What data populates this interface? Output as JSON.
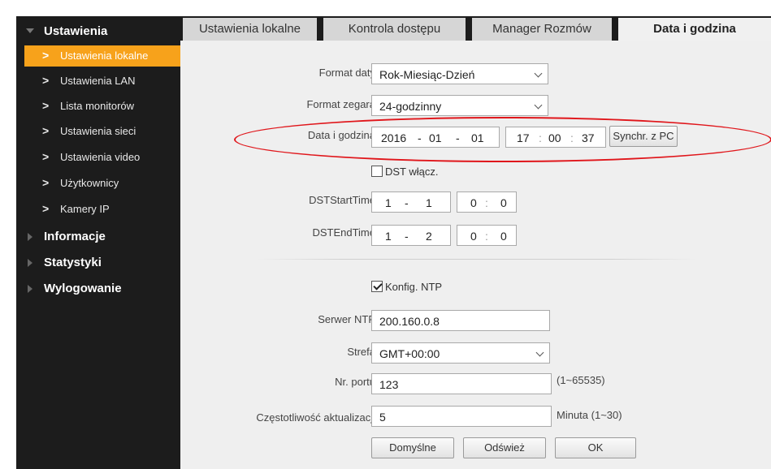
{
  "sidebar": {
    "sections": [
      {
        "label": "Ustawienia",
        "expanded": true
      },
      {
        "label": "Informacje",
        "expanded": false
      },
      {
        "label": "Statystyki",
        "expanded": false
      },
      {
        "label": "Wylogowanie",
        "expanded": false
      }
    ],
    "items": [
      {
        "label": "Ustawienia lokalne",
        "active": true
      },
      {
        "label": "Ustawienia LAN"
      },
      {
        "label": "Lista monitorów"
      },
      {
        "label": "Ustawienia sieci"
      },
      {
        "label": "Ustawienia video"
      },
      {
        "label": "Użytkownicy"
      },
      {
        "label": "Kamery IP"
      }
    ],
    "chevron": ">"
  },
  "tabs": [
    {
      "label": "Ustawienia lokalne"
    },
    {
      "label": "Kontrola dostępu"
    },
    {
      "label": "Manager Rozmów"
    },
    {
      "label": "Data i godzina",
      "active": true
    }
  ],
  "form": {
    "date_format": {
      "label": "Format daty",
      "value": "Rok-Miesiąc-Dzień"
    },
    "clock_format": {
      "label": "Format zegara",
      "value": "24-godzinny"
    },
    "datetime": {
      "label": "Data i godzina",
      "year": "2016",
      "month": "01",
      "day": "01",
      "hour": "17",
      "minute": "00",
      "second": "37",
      "date_sep": "-",
      "time_sep": ":",
      "sync_button": "Synchr. z PC"
    },
    "dst_enable": {
      "label": "DST włącz.",
      "checked": false
    },
    "dst_start": {
      "label": "DSTStartTime",
      "month": "1",
      "day": "1",
      "hour": "0",
      "minute": "0"
    },
    "dst_end": {
      "label": "DSTEndTime",
      "month": "1",
      "day": "2",
      "hour": "0",
      "minute": "0"
    },
    "ntp_enable": {
      "label": "Konfig. NTP",
      "checked": true
    },
    "ntp_server": {
      "label": "Serwer NTP",
      "value": "200.160.0.8"
    },
    "timezone": {
      "label": "Strefa",
      "value": "GMT+00:00"
    },
    "port": {
      "label": "Nr. portu",
      "value": "123",
      "hint": "(1~65535)"
    },
    "update_freq": {
      "label": "Częstotliwość aktualizacji",
      "value": "5",
      "hint": "Minuta (1~30)"
    },
    "buttons": {
      "default": "Domyślne",
      "refresh": "Odśwież",
      "ok": "OK"
    }
  },
  "colors": {
    "sidebar_bg": "#1c1c1c",
    "active_item": "#f7a21b",
    "content_bg": "#efefef",
    "highlight_ellipse": "#e0161b"
  },
  "icons": {
    "expanded_section": "triangle-down-icon",
    "collapsed_section": "triangle-right-icon",
    "dropdown": "chevron-down-icon"
  }
}
